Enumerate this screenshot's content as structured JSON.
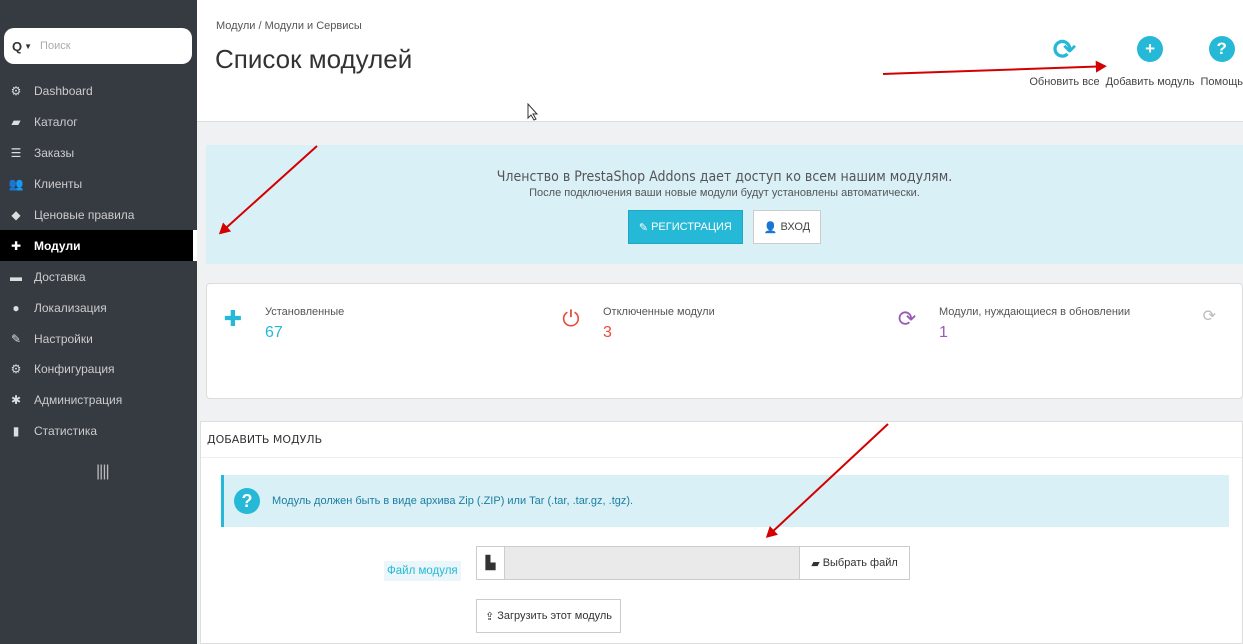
{
  "sidebar": {
    "search": {
      "icon": "search-icon",
      "placeholder": "Поиск"
    },
    "items": [
      {
        "label": "Dashboard",
        "icon": "dashboard-icon",
        "glyph": "⚙"
      },
      {
        "label": "Каталог",
        "icon": "book-icon",
        "glyph": "▰"
      },
      {
        "label": "Заказы",
        "icon": "orders-icon",
        "glyph": "☰"
      },
      {
        "label": "Клиенты",
        "icon": "users-icon",
        "glyph": "👥"
      },
      {
        "label": "Ценовые правила",
        "icon": "tag-icon",
        "glyph": "◆"
      },
      {
        "label": "Модули",
        "icon": "puzzle-icon",
        "glyph": "✚",
        "active": true
      },
      {
        "label": "Доставка",
        "icon": "truck-icon",
        "glyph": "▬"
      },
      {
        "label": "Локализация",
        "icon": "globe-icon",
        "glyph": "●"
      },
      {
        "label": "Настройки",
        "icon": "wrench-icon",
        "glyph": "✎"
      },
      {
        "label": "Конфигурация",
        "icon": "cogs-icon",
        "glyph": "⚙"
      },
      {
        "label": "Администрация",
        "icon": "gear-icon",
        "glyph": "✱"
      },
      {
        "label": "Статистика",
        "icon": "bar-chart-icon",
        "glyph": "▮"
      }
    ],
    "collapse": "||||"
  },
  "header": {
    "breadcrumb": "Модули  /  Модули и Сервисы",
    "title": "Список модулей",
    "toolbar": {
      "refresh_label": "Обновить все",
      "add_label": "Добавить модуль",
      "help_label": "Помощь"
    }
  },
  "addons": {
    "title": "Членство в PrestaShop Addons дает доступ ко всем нашим модулям.",
    "subtitle": "После подключения ваши новые модули будут установлены автоматически.",
    "register_label": "РЕГИСТРАЦИЯ",
    "login_label": "ВХОД"
  },
  "stats": {
    "installed": {
      "label": "Установленные",
      "value": "67",
      "color": "#25b9d7"
    },
    "disabled": {
      "label": "Отключенные модули",
      "value": "3",
      "color": "#e74c3c"
    },
    "updates": {
      "label": "Модули, нуждающиеся в обновлении",
      "value": "1",
      "color": "#9b59b6"
    }
  },
  "add_module": {
    "heading": "ДОБАВИТЬ МОДУЛЬ",
    "alert": "Модуль должен быть в виде архива Zip (.ZIP) или Tar (.tar, .tar.gz, .tgz).",
    "file_label": "Файл модуля",
    "choose_file": "Выбрать файл",
    "upload": "Загрузить этот модуль"
  },
  "colors": {
    "accent": "#25b9d7",
    "sidebar": "#363a41",
    "arrow": "#d40000"
  }
}
